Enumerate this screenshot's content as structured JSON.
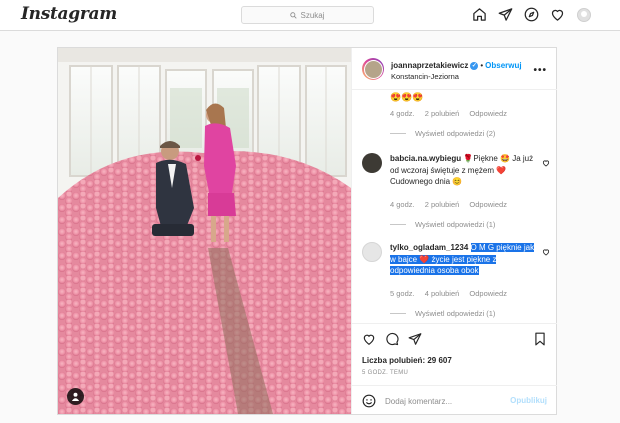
{
  "brand": "Instagram",
  "search": {
    "placeholder": "Szukaj"
  },
  "post": {
    "username": "joannaprzetakiewicz",
    "follow_label": "Obserwuj",
    "location": "Konstancin-Jeziorna",
    "first_comment_emojis": "😍😍😍",
    "first_comment_meta": {
      "time": "4 godz.",
      "likes": "2 polubień",
      "reply": "Odpowiedz"
    },
    "first_replies": "Wyświetl odpowiedzi (2)",
    "comments": [
      {
        "user": "babcia.na.wybiegu",
        "text": "🌹Piękne 🤩 Ja już od wczoraj świętuje z mężem ❤️ Cudownego dnia 😊",
        "time": "4 godz.",
        "likes": "2 polubień",
        "reply": "Odpowiedz",
        "replies": "Wyświetl odpowiedzi (1)"
      },
      {
        "user": "tylko_ogladam_1234",
        "text": "O M G pięknie jak w bajce ❤️ życie jest piękne z odpowiednia osoba obok",
        "time": "5 godz.",
        "likes": "4 polubień",
        "reply": "Odpowiedz",
        "replies": "Wyświetl odpowiedzi (1)"
      }
    ],
    "likes_label": "Liczba polubień: 29 607",
    "timestamp": "5 GODZ. TEMU",
    "comment_placeholder": "Dodaj komentarz...",
    "publish_label": "Opublikuj"
  },
  "colors": {
    "accent": "#0095f6",
    "selection": "#1a73e8",
    "verified": "#3897f0"
  }
}
